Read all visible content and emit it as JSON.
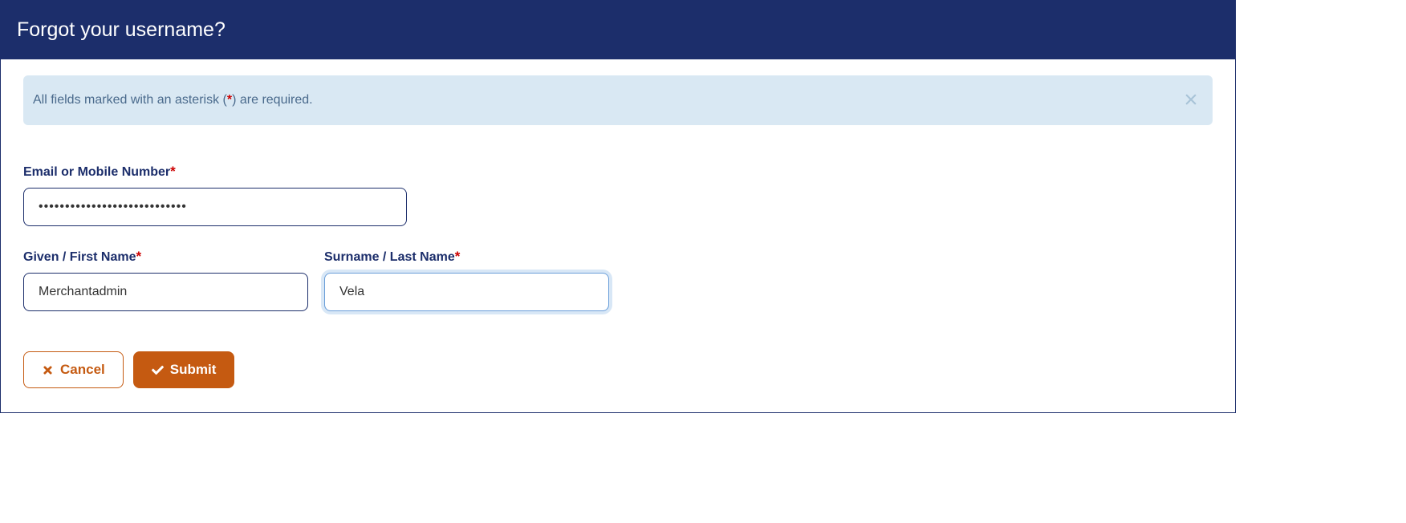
{
  "header": {
    "title": "Forgot your username?"
  },
  "alert": {
    "prefix": "All fields marked with an asterisk (",
    "star": "*",
    "suffix": ") are required."
  },
  "form": {
    "email": {
      "label": "Email or Mobile Number",
      "value": "****************************"
    },
    "firstName": {
      "label": "Given / First Name",
      "value": "Merchantadmin"
    },
    "lastName": {
      "label": "Surname / Last Name",
      "value": "Vela"
    }
  },
  "buttons": {
    "cancel": "Cancel",
    "submit": "Submit"
  }
}
